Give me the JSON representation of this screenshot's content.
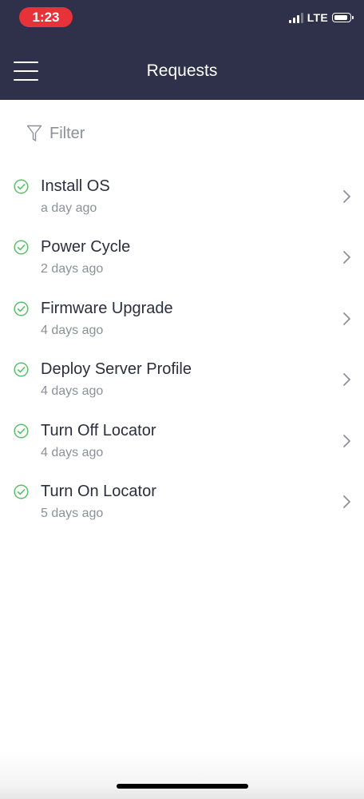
{
  "status_bar": {
    "time": "1:23",
    "network": "LTE",
    "time_pill_color": "#e8323a",
    "icons": [
      "signal-icon",
      "battery-icon"
    ]
  },
  "header": {
    "title": "Requests",
    "menu_icon": "hamburger-menu-icon",
    "background_color": "#2f3049"
  },
  "filter": {
    "placeholder": "Filter",
    "icon": "funnel-icon"
  },
  "requests": [
    {
      "title": "Install OS",
      "time": "a day ago",
      "status": "completed",
      "status_icon": "check-circle-icon"
    },
    {
      "title": "Power Cycle",
      "time": "2 days ago",
      "status": "completed",
      "status_icon": "check-circle-icon"
    },
    {
      "title": "Firmware Upgrade",
      "time": "4 days ago",
      "status": "completed",
      "status_icon": "check-circle-icon"
    },
    {
      "title": "Deploy Server Profile",
      "time": "4 days ago",
      "status": "completed",
      "status_icon": "check-circle-icon"
    },
    {
      "title": "Turn Off Locator",
      "time": "4 days ago",
      "status": "completed",
      "status_icon": "check-circle-icon"
    },
    {
      "title": "Turn On Locator",
      "time": "5 days ago",
      "status": "completed",
      "status_icon": "check-circle-icon"
    }
  ],
  "colors": {
    "success_green": "#5bbf6a",
    "chevron_gray": "#8d9099",
    "title_text": "#2c2d3f"
  }
}
